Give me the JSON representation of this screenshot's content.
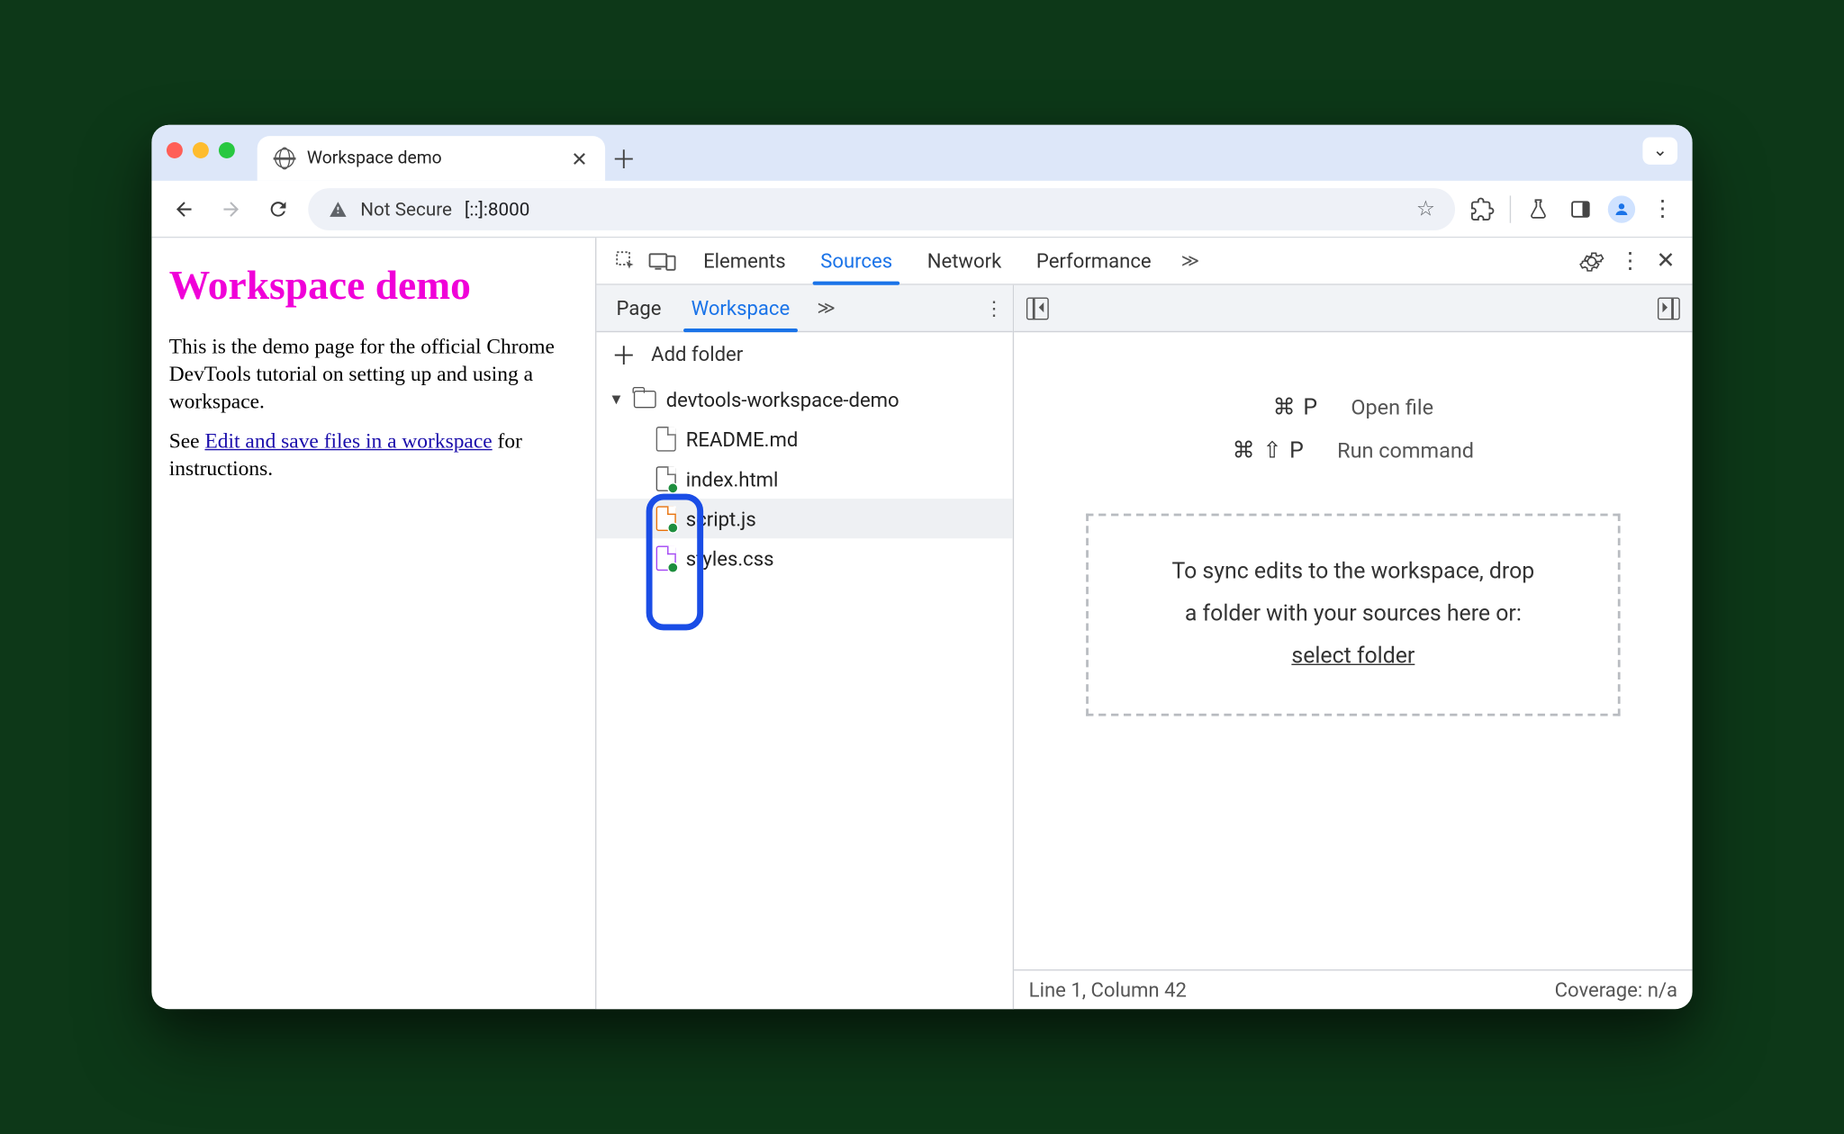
{
  "browser": {
    "tab_title": "Workspace demo",
    "address": {
      "security_label": "Not Secure",
      "url": "[::]:8000"
    },
    "toolbar_icons": {
      "back": "←",
      "forward": "→",
      "reload": "⟳",
      "extensions": "puzzle",
      "divider": "|",
      "labs": "⚗",
      "panel": "panel",
      "menu": "⋮"
    }
  },
  "page": {
    "heading": "Workspace demo",
    "para1": "This is the demo page for the official Chrome DevTools tutorial on setting up and using a workspace.",
    "para2_pre": "See ",
    "para2_link": "Edit and save files in a workspace",
    "para2_post": " for instructions."
  },
  "devtools": {
    "tabs": [
      "Elements",
      "Sources",
      "Network",
      "Performance"
    ],
    "active_tab": "Sources",
    "sources": {
      "nav_tabs": {
        "page": "Page",
        "workspace": "Workspace"
      },
      "add_folder": "Add folder",
      "tree": {
        "folder": "devtools-workspace-demo",
        "files": [
          {
            "name": "README.md",
            "type": "md",
            "mapped": false
          },
          {
            "name": "index.html",
            "type": "html",
            "mapped": true
          },
          {
            "name": "script.js",
            "type": "js",
            "mapped": true
          },
          {
            "name": "styles.css",
            "type": "css",
            "mapped": true
          }
        ],
        "selected": "script.js"
      },
      "shortcuts": {
        "open_file": {
          "keys": "⌘ P",
          "label": "Open file"
        },
        "run_command": {
          "keys": "⌘ ⇧ P",
          "label": "Run command"
        }
      },
      "dropzone": {
        "line1": "To sync edits to the workspace, drop",
        "line2": "a folder with your sources here or:",
        "select": "select folder"
      },
      "status": {
        "pos": "Line 1, Column 42",
        "coverage": "Coverage: n/a"
      }
    }
  }
}
